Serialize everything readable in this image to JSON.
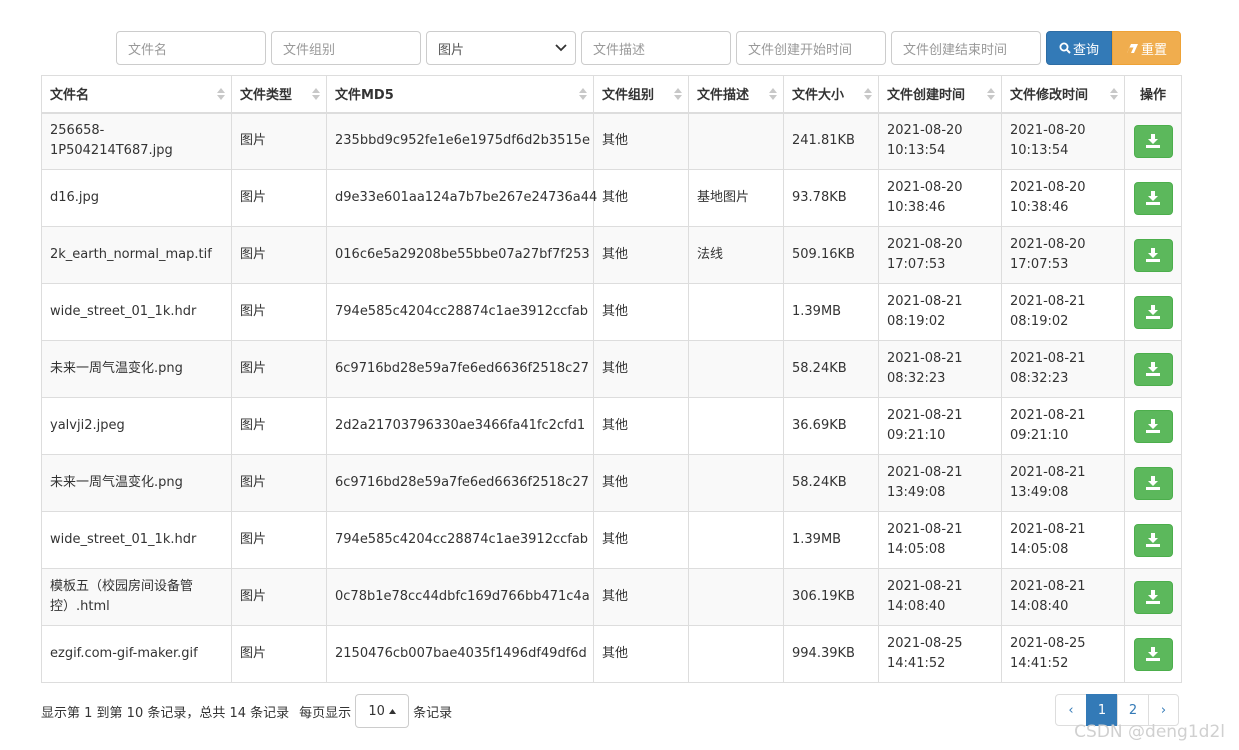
{
  "search": {
    "filename_placeholder": "文件名",
    "group_placeholder": "文件组别",
    "type_selected": "图片",
    "desc_placeholder": "文件描述",
    "start_placeholder": "文件创建开始时间",
    "end_placeholder": "文件创建结束时间",
    "query_label": "查询",
    "reset_label": "重置"
  },
  "table": {
    "headers": [
      "文件名",
      "文件类型",
      "文件MD5",
      "文件组别",
      "文件描述",
      "文件大小",
      "文件创建时间",
      "文件修改时间",
      "操作"
    ],
    "rows": [
      {
        "name": "256658-1P504214T687.jpg",
        "type": "图片",
        "md5": "235bbd9c952fe1e6e1975df6d2b3515e",
        "group": "其他",
        "desc": "",
        "size": "241.81KB",
        "created_date": "2021-08-20",
        "created_time": "10:13:54",
        "modified_date": "2021-08-20",
        "modified_time": "10:13:54"
      },
      {
        "name": "d16.jpg",
        "type": "图片",
        "md5": "d9e33e601aa124a7b7be267e24736a44",
        "group": "其他",
        "desc": "基地图片",
        "size": "93.78KB",
        "created_date": "2021-08-20",
        "created_time": "10:38:46",
        "modified_date": "2021-08-20",
        "modified_time": "10:38:46"
      },
      {
        "name": "2k_earth_normal_map.tif",
        "type": "图片",
        "md5": "016c6e5a29208be55bbe07a27bf7f253",
        "group": "其他",
        "desc": "法线",
        "size": "509.16KB",
        "created_date": "2021-08-20",
        "created_time": "17:07:53",
        "modified_date": "2021-08-20",
        "modified_time": "17:07:53"
      },
      {
        "name": "wide_street_01_1k.hdr",
        "type": "图片",
        "md5": "794e585c4204cc28874c1ae3912ccfab",
        "group": "其他",
        "desc": "",
        "size": "1.39MB",
        "created_date": "2021-08-21",
        "created_time": "08:19:02",
        "modified_date": "2021-08-21",
        "modified_time": "08:19:02"
      },
      {
        "name": "未来一周气温变化.png",
        "type": "图片",
        "md5": "6c9716bd28e59a7fe6ed6636f2518c27",
        "group": "其他",
        "desc": "",
        "size": "58.24KB",
        "created_date": "2021-08-21",
        "created_time": "08:32:23",
        "modified_date": "2021-08-21",
        "modified_time": "08:32:23"
      },
      {
        "name": "yalvji2.jpeg",
        "type": "图片",
        "md5": "2d2a21703796330ae3466fa41fc2cfd1",
        "group": "其他",
        "desc": "",
        "size": "36.69KB",
        "created_date": "2021-08-21",
        "created_time": "09:21:10",
        "modified_date": "2021-08-21",
        "modified_time": "09:21:10"
      },
      {
        "name": "未来一周气温变化.png",
        "type": "图片",
        "md5": "6c9716bd28e59a7fe6ed6636f2518c27",
        "group": "其他",
        "desc": "",
        "size": "58.24KB",
        "created_date": "2021-08-21",
        "created_time": "13:49:08",
        "modified_date": "2021-08-21",
        "modified_time": "13:49:08"
      },
      {
        "name": "wide_street_01_1k.hdr",
        "type": "图片",
        "md5": "794e585c4204cc28874c1ae3912ccfab",
        "group": "其他",
        "desc": "",
        "size": "1.39MB",
        "created_date": "2021-08-21",
        "created_time": "14:05:08",
        "modified_date": "2021-08-21",
        "modified_time": "14:05:08"
      },
      {
        "name": "模板五（校园房间设备管控）.html",
        "type": "图片",
        "md5": "0c78b1e78cc44dbfc169d766bb471c4a",
        "group": "其他",
        "desc": "",
        "size": "306.19KB",
        "created_date": "2021-08-21",
        "created_time": "14:08:40",
        "modified_date": "2021-08-21",
        "modified_time": "14:08:40"
      },
      {
        "name": "ezgif.com-gif-maker.gif",
        "type": "图片",
        "md5": "2150476cb007bae4035f1496df49df6d",
        "group": "其他",
        "desc": "",
        "size": "994.39KB",
        "created_date": "2021-08-25",
        "created_time": "14:41:52",
        "modified_date": "2021-08-25",
        "modified_time": "14:41:52"
      }
    ]
  },
  "footer": {
    "summary": "显示第 1 到第 10 条记录，总共 14 条记录",
    "per_page_prefix": "每页显示",
    "page_size": "10",
    "per_page_suffix": "条记录"
  },
  "pagination": {
    "prev": "‹",
    "pages": [
      "1",
      "2"
    ],
    "next": "›",
    "active_page": "1"
  },
  "watermark": "CSDN @deng1d2l",
  "colors": {
    "primary": "#337ab7",
    "warning": "#f0ad4e",
    "success": "#5cb85c"
  },
  "icons": {
    "query": "search-icon",
    "reset": "eraser-icon",
    "download": "download-icon",
    "sort": "sort-icon",
    "select": "chevron-down-icon",
    "page_size": "caret-up-icon"
  }
}
